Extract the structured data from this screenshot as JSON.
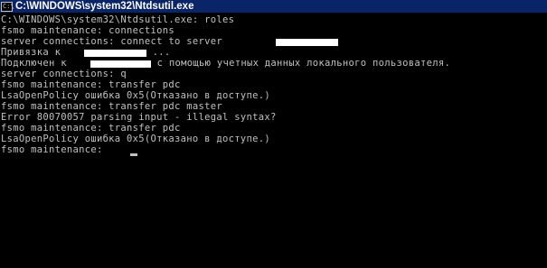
{
  "window": {
    "title": "C:\\WINDOWS\\system32\\Ntdsutil.exe",
    "icon": "console-icon",
    "icon_glyph": "C:\\"
  },
  "console": {
    "text_color": "#c0c0c0",
    "background": "#000000",
    "lines": [
      "C:\\WINDOWS\\system32\\Ntdsutil.exe: roles",
      "fsmo maintenance: connections",
      "server connections: connect to server",
      "Привязка к ",
      "Подключен к ",
      "server connections: q",
      "fsmo maintenance: transfer pdc",
      "LsaOpenPolicy ошибка 0x5(Отказано в доступе.)",
      "fsmo maintenance: transfer pdc master",
      "Error 80070057 parsing input - illegal syntax?",
      "fsmo maintenance: transfer pdc",
      "LsaOpenPolicy ошибка 0x5(Отказано в доступе.)",
      "fsmo maintenance: "
    ],
    "line3_suffix": " ...",
    "line4_suffix": " с помощью учетных данных локального пользователя."
  }
}
